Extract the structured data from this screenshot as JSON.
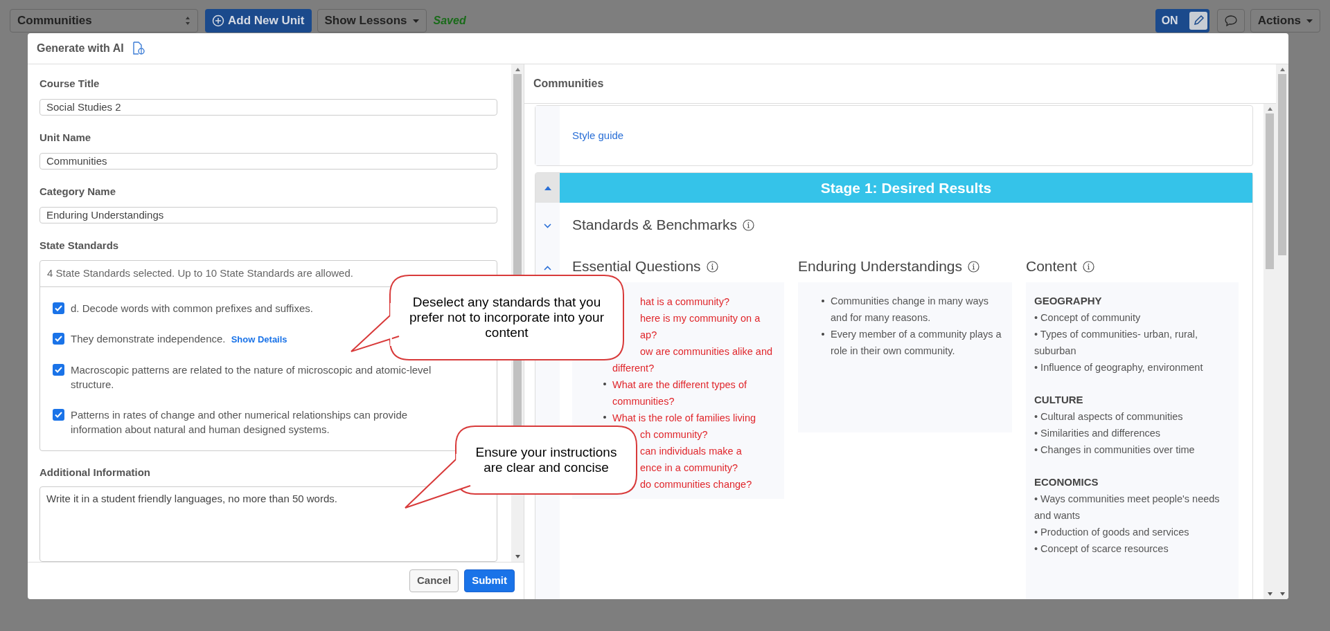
{
  "top_bar": {
    "unit_select": "Communities",
    "add_button": "Add New Unit",
    "lessons_button": "Show Lessons",
    "save_status": "Saved",
    "toggle": {
      "label": "ON",
      "on": true
    },
    "actions_button": "Actions"
  },
  "modal": {
    "title": "Generate with AI",
    "form": {
      "fields": [
        {
          "label": "Course Title",
          "value": "Social Studies 2"
        },
        {
          "label": "Unit Name",
          "value": "Communities"
        },
        {
          "label": "Category Name",
          "value": "Enduring Understandings"
        }
      ],
      "standards": {
        "label": "State Standards",
        "summary": "4 State Standards selected. Up to 10 State Standards are allowed.",
        "items": [
          {
            "text": "d. Decode words with common prefixes and suffixes.",
            "checked": true
          },
          {
            "text": "They demonstrate independence.",
            "checked": true,
            "link": "Show Details"
          },
          {
            "text": "Macroscopic patterns are related to the nature of microscopic and atomic-level structure.",
            "checked": true
          },
          {
            "text": "Patterns in rates of change and other numerical relationships can provide information about natural and human designed systems.",
            "checked": true
          }
        ]
      },
      "additional": {
        "label": "Additional Information",
        "value": "Write it in a student friendly languages, no more than 50 words."
      },
      "buttons": [
        {
          "label": "Cancel",
          "kind": "secondary"
        },
        {
          "label": "Submit",
          "kind": "primary"
        }
      ]
    },
    "preview": {
      "title": "Communities",
      "style_link": "Style guide",
      "stage": {
        "title": "Stage 1: Desired Results",
        "expanded": true
      },
      "sections": [
        {
          "title": "Standards & Benchmarks",
          "expanded": false
        },
        {
          "title": "Essential Questions",
          "expanded": true
        }
      ],
      "columns": [
        {
          "title": "Enduring Understandings",
          "items": [
            [
              "Communities change in many ways and for many reasons."
            ],
            [
              "Every member of a community plays a role in their own community."
            ]
          ]
        },
        {
          "title": "Content",
          "groups": [
            {
              "heading": "GEOGRAPHY",
              "items": [
                "• Concept of community",
                "• Types of communities- urban, rural, suburban",
                "• Influence of geography, environment"
              ]
            },
            {
              "heading": "CULTURE",
              "items": [
                "• Cultural aspects of communities",
                "• Similarities and differences",
                "• Changes in communities over time"
              ]
            },
            {
              "heading": "ECONOMICS",
              "items": [
                "• Ways communities meet people's needs and wants",
                "• Production of goods and services",
                "• Concept of scarce resources"
              ]
            }
          ]
        }
      ],
      "questions": [
        {
          "lines": [
            {
              "text": "hat is a community?",
              "covered": true
            }
          ]
        },
        {
          "lines": [
            {
              "text": "here is my community on a",
              "covered": true
            },
            {
              "text": "ap?",
              "covered": true
            }
          ]
        },
        {
          "lines": [
            {
              "text": "ow are communities alike and",
              "covered": true
            },
            {
              "text": "different?"
            }
          ]
        },
        {
          "lines": [
            {
              "text": "What are the different types of"
            },
            {
              "text": "communities?"
            }
          ]
        },
        {
          "lines": [
            {
              "text": "What is the role of families living"
            },
            {
              "text": "ch community?",
              "covered": true
            }
          ]
        },
        {
          "lines": [
            {
              "text": "can individuals make a",
              "covered": true
            },
            {
              "text": "ence in a community?",
              "covered": true
            }
          ]
        },
        {
          "lines": [
            {
              "text": "do communities change?",
              "covered": true
            }
          ]
        }
      ]
    }
  },
  "callouts": [
    {
      "text": "Deselect any standards that you prefer not to incorporate into your content"
    },
    {
      "text": "Ensure your instructions are clear and concise"
    }
  ]
}
